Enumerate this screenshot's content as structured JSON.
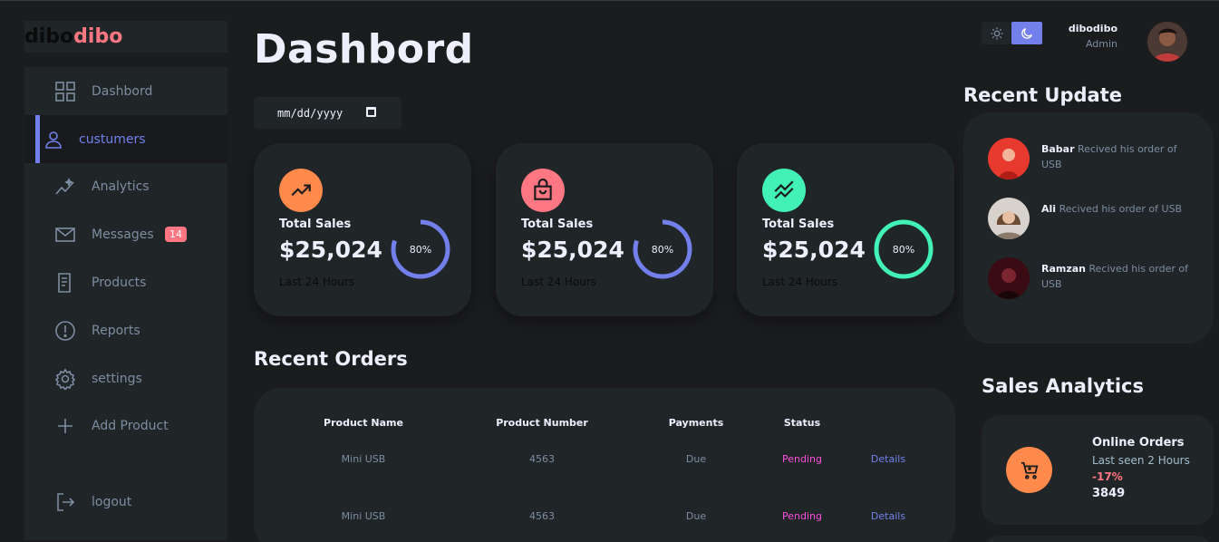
{
  "brand": {
    "part1": "dibo",
    "part2": "dibo"
  },
  "sidebar": {
    "items": [
      {
        "label": "Dashbord",
        "icon": "grid-icon"
      },
      {
        "label": "custumers",
        "icon": "person-icon",
        "active": true
      },
      {
        "label": "Analytics",
        "icon": "analytics-icon"
      },
      {
        "label": "Messages",
        "icon": "mail-icon",
        "badge": "14"
      },
      {
        "label": "Products",
        "icon": "receipt-icon"
      },
      {
        "label": "Reports",
        "icon": "report-icon"
      },
      {
        "label": "settings",
        "icon": "gear-icon"
      },
      {
        "label": "Add Product",
        "icon": "plus-icon"
      },
      {
        "label": "logout",
        "icon": "logout-icon"
      }
    ]
  },
  "header": {
    "title": "Dashbord",
    "date_placeholder": "mm/dd/yyyy"
  },
  "cards": [
    {
      "title": "Total Sales",
      "value": "$25,024",
      "subtitle": "Last 24 Hours",
      "percent_label": "80%",
      "percent": 0.8,
      "icon": "trend-up-icon",
      "icon_color": "#ff8a4c",
      "ring_color": "#7380ec"
    },
    {
      "title": "Total Sales",
      "value": "$25,024",
      "subtitle": "Last 24 Hours",
      "percent_label": "80%",
      "percent": 0.8,
      "icon": "shopping-bag-icon",
      "icon_color": "#ff7782",
      "ring_color": "#7380ec"
    },
    {
      "title": "Total Sales",
      "value": "$25,024",
      "subtitle": "Last 24 Hours",
      "percent_label": "80%",
      "percent": 1.0,
      "icon": "stocks-icon",
      "icon_color": "#41f1b6",
      "ring_color": "#41f1b6"
    }
  ],
  "orders": {
    "title": "Recent Orders",
    "headers": [
      "Product Name",
      "Product Number",
      "Payments",
      "Status"
    ],
    "rows": [
      {
        "name": "Mini USB",
        "number": "4563",
        "payment": "Due",
        "status": "Pending",
        "action": "Details"
      },
      {
        "name": "Mini USB",
        "number": "4563",
        "payment": "Due",
        "status": "Pending",
        "action": "Details"
      }
    ]
  },
  "profile": {
    "name": "dibodibo",
    "role": "Admin"
  },
  "updates": {
    "title": "Recent Update",
    "items": [
      {
        "name": "Babar",
        "text": "Recived his order of USB"
      },
      {
        "name": "Ali",
        "text": "Recived his order of USB"
      },
      {
        "name": "Ramzan",
        "text": "Recived his order of USB"
      }
    ]
  },
  "analytics": {
    "title": "Sales Analytics",
    "card": {
      "title": "Online Orders",
      "subtitle": "Last seen 2 Hours",
      "percent": "-17%",
      "value": "3849"
    }
  },
  "colors": {
    "primary": "#7380ec",
    "danger": "#ff7782",
    "success": "#41f1b6",
    "warning": "#ff8a4c",
    "pending": "#ff4edc",
    "background": "#1b1c1e",
    "panel": "#202528"
  }
}
